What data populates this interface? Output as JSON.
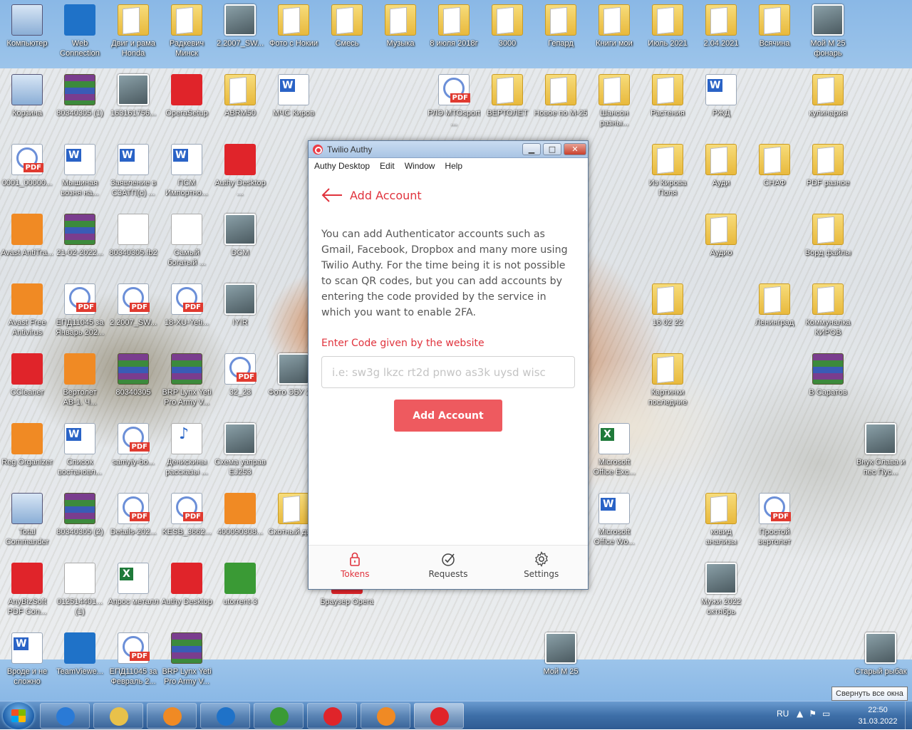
{
  "desktop": {
    "icons": [
      {
        "label": "Компьютер",
        "type": "sys"
      },
      {
        "label": "Web Connection",
        "type": "blue"
      },
      {
        "label": "Двиг и рама Honda",
        "type": "folder"
      },
      {
        "label": "Радкевич Минск",
        "type": "folder"
      },
      {
        "label": "2.2007_SW...",
        "type": "photo"
      },
      {
        "label": "Фото с Нокии",
        "type": "folder"
      },
      {
        "label": "Смесь",
        "type": "folder"
      },
      {
        "label": "Музыка",
        "type": "folder"
      },
      {
        "label": "8 июля 2018г",
        "type": "folder"
      },
      {
        "label": "3000",
        "type": "folder"
      },
      {
        "label": "Гепард",
        "type": "folder"
      },
      {
        "label": "Книги мои",
        "type": "folder"
      },
      {
        "label": "Июль 2021",
        "type": "folder"
      },
      {
        "label": "2.04.2021",
        "type": "folder"
      },
      {
        "label": "Всячина",
        "type": "folder"
      },
      {
        "label": "Мой М 25 фонарь",
        "type": "photo"
      },
      {
        "label": "Корзина",
        "type": "sys"
      },
      {
        "label": "80340305 (1)",
        "type": "rar"
      },
      {
        "label": "163161756...",
        "type": "photo"
      },
      {
        "label": "OperaSetup",
        "type": "red"
      },
      {
        "label": "ABRM50",
        "type": "folder"
      },
      {
        "label": "МЧС Киров",
        "type": "word"
      },
      {
        "label": "РЛЭ MTOsport ...",
        "type": "pdf"
      },
      {
        "label": "ВЕРТОЛЕТ",
        "type": "folder"
      },
      {
        "label": "Новое по М-25",
        "type": "folder"
      },
      {
        "label": "Шансон разны...",
        "type": "folder"
      },
      {
        "label": "Растения",
        "type": "folder"
      },
      {
        "label": "РЖД",
        "type": "word"
      },
      {
        "label": "кулинария",
        "type": "folder"
      },
      {
        "label": "0001_00000...",
        "type": "pdf"
      },
      {
        "label": "Мышиная возня на...",
        "type": "word"
      },
      {
        "label": "Заявление в СЗАТП(с) ...",
        "type": "word"
      },
      {
        "label": "ПСМ Импортно...",
        "type": "word"
      },
      {
        "label": "Authy Desktop ...",
        "type": "red"
      },
      {
        "label": "Из Кирова Поля",
        "type": "folder"
      },
      {
        "label": "Ауди",
        "type": "folder"
      },
      {
        "label": "СНАФ",
        "type": "folder"
      },
      {
        "label": "PDF разное",
        "type": "folder"
      },
      {
        "label": "Avast AntiTra...",
        "type": "orange"
      },
      {
        "label": "21-02-2022...",
        "type": "rar"
      },
      {
        "label": "80340305.fb2",
        "type": "file"
      },
      {
        "label": "Самый богатый ...",
        "type": "file"
      },
      {
        "label": "DCM",
        "type": "photo"
      },
      {
        "label": "Аудио",
        "type": "folder"
      },
      {
        "label": "Ворд файлы",
        "type": "folder"
      },
      {
        "label": "Avast Free Antivirus",
        "type": "orange"
      },
      {
        "label": "ЕПД11045 за Январь 202...",
        "type": "pdf"
      },
      {
        "label": "2.2007_SW...",
        "type": "pdf"
      },
      {
        "label": "18-XU-Yeti...",
        "type": "pdf"
      },
      {
        "label": "IYIR",
        "type": "photo"
      },
      {
        "label": "16 02 22",
        "type": "folder"
      },
      {
        "label": "Ленинград",
        "type": "folder"
      },
      {
        "label": "Коммуналка КИРОВ",
        "type": "folder"
      },
      {
        "label": "CCleaner",
        "type": "red"
      },
      {
        "label": "Вертолет АВ-1. Ч...",
        "type": "orange"
      },
      {
        "label": "80340305",
        "type": "rar"
      },
      {
        "label": "BRP Lynx Yeti Pro Army V...",
        "type": "rar"
      },
      {
        "label": "32_23",
        "type": "pdf"
      },
      {
        "label": "Фото ЭБУ 253",
        "type": "photo"
      },
      {
        "label": "Картинки последние",
        "type": "folder"
      },
      {
        "label": "В Саратов",
        "type": "rar"
      },
      {
        "label": "Reg Organizer",
        "type": "orange"
      },
      {
        "label": "Список востановл...",
        "type": "word"
      },
      {
        "label": "samyiy-bo...",
        "type": "pdf"
      },
      {
        "label": "Денискины рассказы ...",
        "type": "mp3"
      },
      {
        "label": "Схема уаправ EJ253",
        "type": "photo"
      },
      {
        "label": "Microsoft Office Exc...",
        "type": "excel"
      },
      {
        "label": "Внук Слава и пес Пус...",
        "type": "photo"
      },
      {
        "label": "Total Commander",
        "type": "sys"
      },
      {
        "label": "80340305 (2)",
        "type": "rar"
      },
      {
        "label": "Details-202...",
        "type": "pdf"
      },
      {
        "label": "KESB_3662...",
        "type": "pdf"
      },
      {
        "label": "400090308...",
        "type": "orange"
      },
      {
        "label": "Скотный двор",
        "type": "folder"
      },
      {
        "label": "Microsoft Office Wo...",
        "type": "word"
      },
      {
        "label": "ковид анализы",
        "type": "folder"
      },
      {
        "label": "Простой вертолет",
        "type": "pdf"
      },
      {
        "label": "AnyBizSoft PDF Con...",
        "type": "red"
      },
      {
        "label": "012514401... (1)",
        "type": "file"
      },
      {
        "label": "Апрос металл",
        "type": "excel"
      },
      {
        "label": "Authy Desktop",
        "type": "red"
      },
      {
        "label": "utorrent-3",
        "type": "green"
      },
      {
        "label": "Браузер Opera",
        "type": "red"
      },
      {
        "label": "Мужи 2022 октябрь",
        "type": "photo"
      },
      {
        "label": "Вроде и не сложно",
        "type": "word"
      },
      {
        "label": "TeamViewe...",
        "type": "blue"
      },
      {
        "label": "ЕПД11045 за Февраль 2...",
        "type": "pdf"
      },
      {
        "label": "BRP Lynx Yeti Pro Army V...",
        "type": "rar"
      },
      {
        "label": "Мой М 25",
        "type": "photo"
      },
      {
        "label": "Старый рыбак",
        "type": "photo"
      }
    ]
  },
  "window": {
    "title": "Twilio Authy",
    "minimize": "▁",
    "maximize": "□",
    "close": "✕",
    "menu": [
      "Authy Desktop",
      "Edit",
      "Window",
      "Help"
    ],
    "header_title": "Add Account",
    "description": "You can add Authenticator accounts such as Gmail, Facebook, Dropbox and many more using Twilio Authy. For the time being it is not possible to scan QR codes, but you can add accounts by entering the code provided by the service in which you want to enable 2FA.",
    "code_label": "Enter Code given by the website",
    "code_placeholder": "i.e: sw3g lkzc rt2d pnwo as3k uysd wisc",
    "code_value": "",
    "add_button": "Add Account",
    "nav": [
      {
        "label": "Tokens",
        "icon": "lock-icon",
        "active": true
      },
      {
        "label": "Requests",
        "icon": "check-circle-icon",
        "active": false
      },
      {
        "label": "Settings",
        "icon": "gear-icon",
        "active": false
      }
    ],
    "accent_color": "#e0333d",
    "button_color": "#ee5a5f"
  },
  "taskbar": {
    "apps": [
      {
        "name": "internet-explorer",
        "color": "#2a7ad6"
      },
      {
        "name": "file-explorer",
        "color": "#e8c14a"
      },
      {
        "name": "media-player",
        "color": "#f08a24"
      },
      {
        "name": "teamviewer",
        "color": "#1f72c8"
      },
      {
        "name": "utorrent",
        "color": "#3a9a35"
      },
      {
        "name": "opera",
        "color": "#e0242a"
      },
      {
        "name": "uc-browser",
        "color": "#f08a24"
      },
      {
        "name": "authy",
        "color": "#e0242a"
      }
    ],
    "language": "RU",
    "time": "22:50",
    "date": "31.03.2022",
    "tooltip": "Свернуть все окна"
  }
}
